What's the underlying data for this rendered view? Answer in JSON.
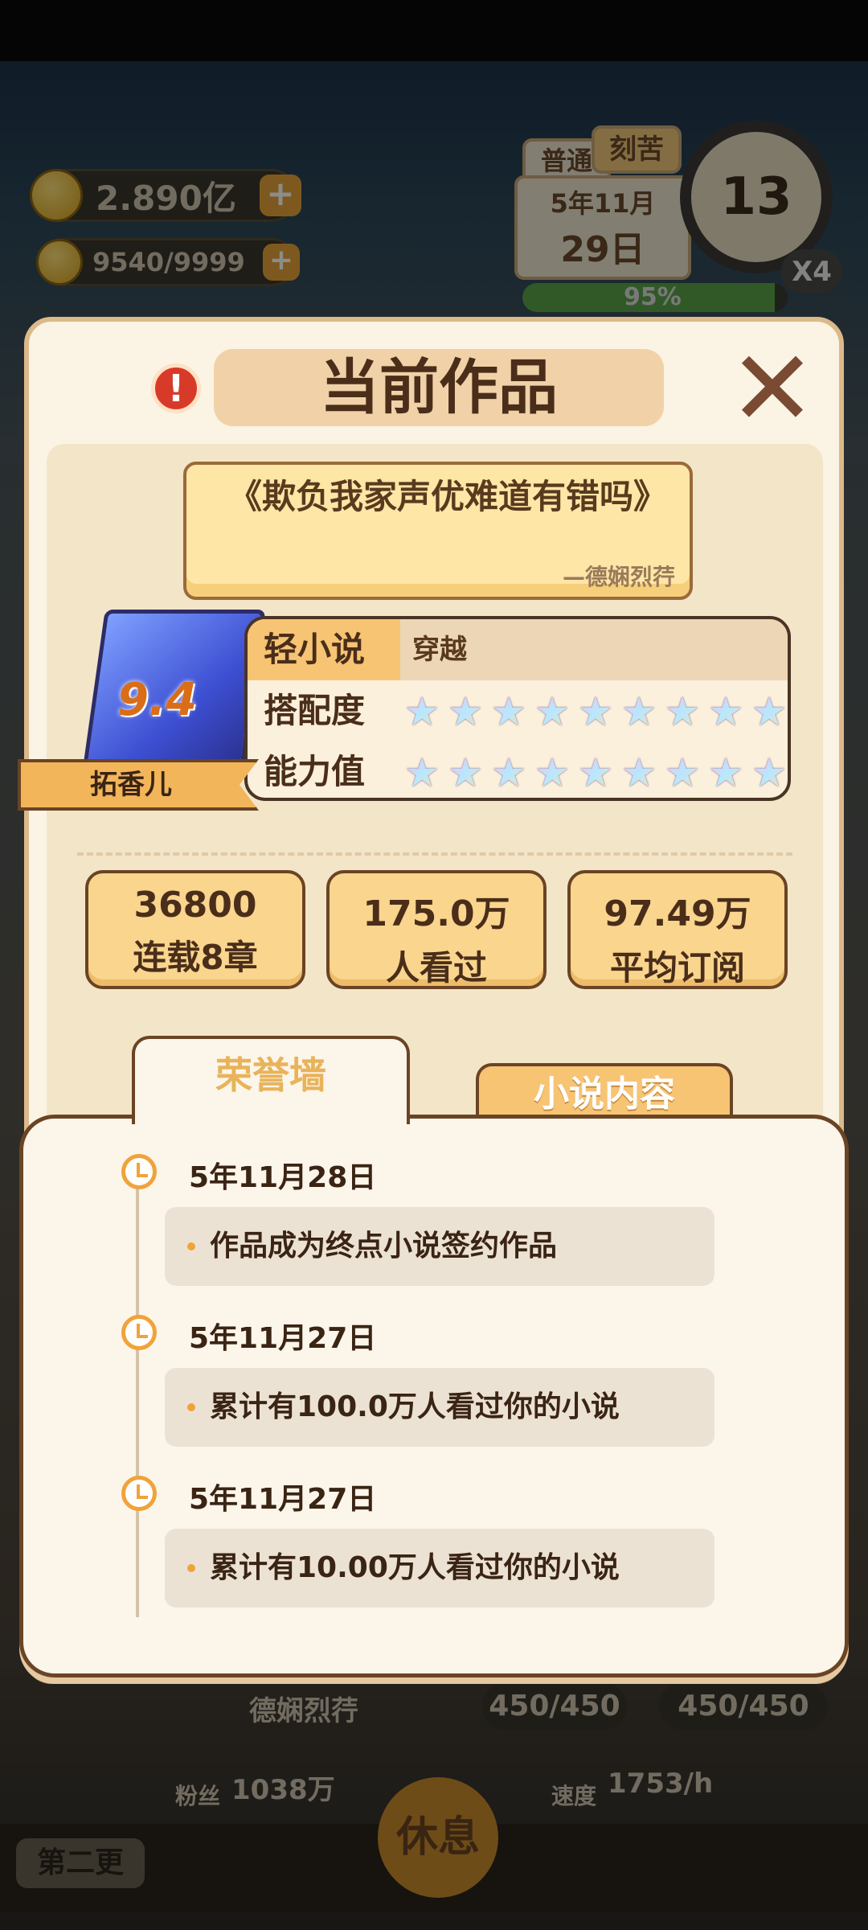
{
  "hud": {
    "coins": "2.890亿",
    "energy": "9540/9999",
    "mode_tab_1": "普通",
    "mode_tab_2": "刻苦",
    "month": "5年11月",
    "day": "29日",
    "clock_number": "13",
    "speed_multiplier": "X4",
    "progress_text": "95%"
  },
  "modal": {
    "title": "当前作品",
    "alert_icon": "!",
    "close_icon": "✕",
    "novel_title": "《欺负我家声优难道有错吗》",
    "novel_author": "—德娴烈荇",
    "book_score": "9.4",
    "genre": "轻小说",
    "subgenre": "穿越",
    "match_label": "搭配度",
    "match_stars": 9,
    "ability_label": "能力值",
    "ability_stars": 9,
    "character_name": "拓香儿",
    "stats": [
      {
        "value": "36800",
        "label": "连载8章"
      },
      {
        "value": "175.0万",
        "label": "人看过"
      },
      {
        "value": "97.49万",
        "label": "平均订阅"
      }
    ],
    "tabs": {
      "active": "荣誉墙",
      "inactive": "小说内容"
    },
    "events": [
      {
        "date": "5年11月28日",
        "text": "作品成为终点小说签约作品"
      },
      {
        "date": "5年11月27日",
        "text": "累计有100.0万人看过你的小说"
      },
      {
        "date": "5年11月27日",
        "text": "累计有10.00万人看过你的小说"
      }
    ]
  },
  "bottom": {
    "author_name": "德娴烈荇",
    "stat_a": "450/450",
    "stat_b": "450/450",
    "fans_label": "粉丝",
    "fans": "1038万",
    "speed_label": "速度",
    "speed": "1753/h",
    "chapter_button": "第二更",
    "rest_button": "休息"
  },
  "colors": {
    "accent": "#f0a33a",
    "panel": "#fbf3e3",
    "border": "#6a4424",
    "close": "#7a4a33"
  }
}
